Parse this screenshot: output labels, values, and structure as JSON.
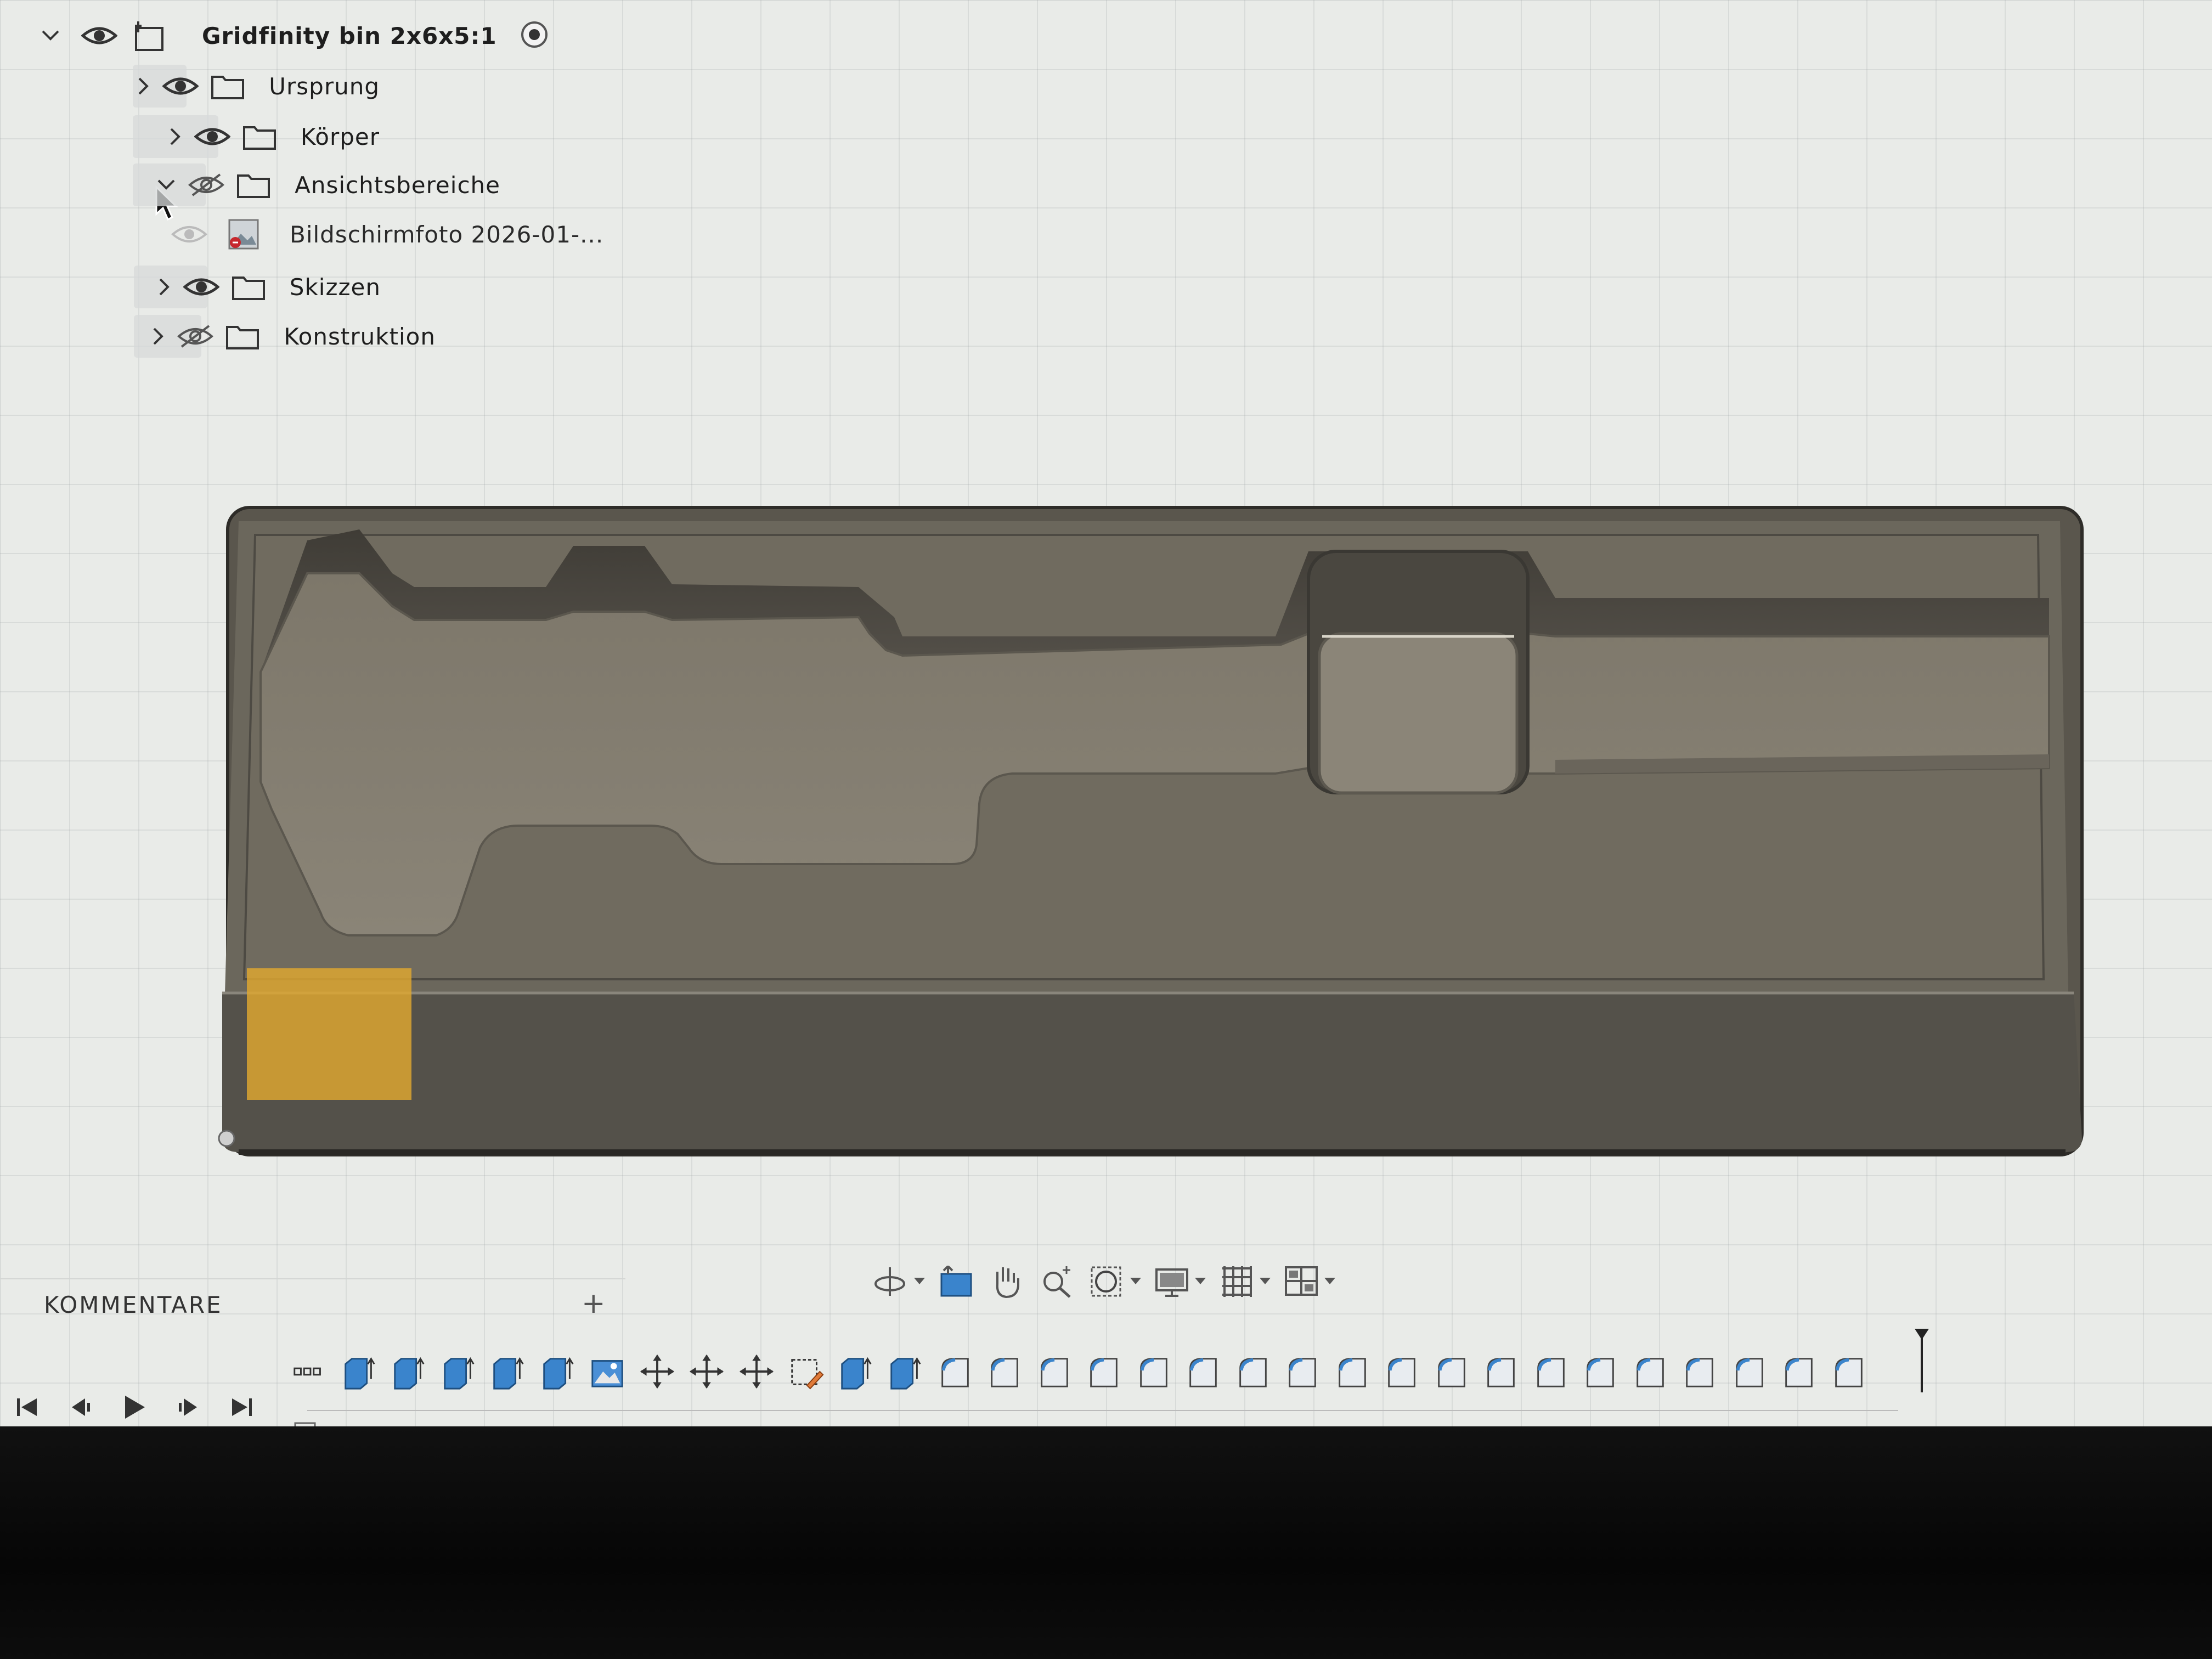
{
  "browser": {
    "root": {
      "label": "Gridfinity bin 2x6x5:1"
    },
    "items": [
      {
        "label": "Ursprung",
        "visible": true,
        "expanded": false
      },
      {
        "label": "Körper",
        "visible": true,
        "expanded": false
      },
      {
        "label": "Ansichtsbereiche",
        "visible": false,
        "expanded": true
      },
      {
        "label": "Bildschirmfoto 2026-01-...",
        "visible": false,
        "child": true
      },
      {
        "label": "Skizzen",
        "visible": true,
        "expanded": false
      },
      {
        "label": "Konstruktion",
        "visible": false,
        "expanded": false
      }
    ]
  },
  "comments": {
    "label": "KOMMENTARE",
    "add": "+"
  },
  "navbar": {
    "tools": [
      "orbit-icon",
      "look-at-icon",
      "pan-icon",
      "zoom-icon",
      "fit-icon",
      "display-settings-icon",
      "grid-icon",
      "viewports-icon"
    ]
  },
  "timeline": {
    "playback": [
      "first-icon",
      "previous-icon",
      "play-icon",
      "next-icon",
      "last-icon"
    ],
    "steps": [
      "sketch-group",
      "extrude",
      "extrude",
      "extrude",
      "extrude",
      "extrude",
      "canvas",
      "move",
      "move",
      "move",
      "sketch",
      "extrude",
      "extrude",
      "fillet",
      "fillet",
      "fillet",
      "fillet",
      "fillet",
      "fillet",
      "fillet",
      "fillet",
      "fillet",
      "fillet",
      "fillet",
      "fillet",
      "fillet",
      "fillet",
      "fillet",
      "fillet",
      "fillet",
      "fillet",
      "fillet"
    ]
  },
  "colors": {
    "background": "#e9ebe8",
    "model_body": "#6a655a",
    "selection_highlight": "#e0a830",
    "feature_blue": "#3a84cc"
  }
}
